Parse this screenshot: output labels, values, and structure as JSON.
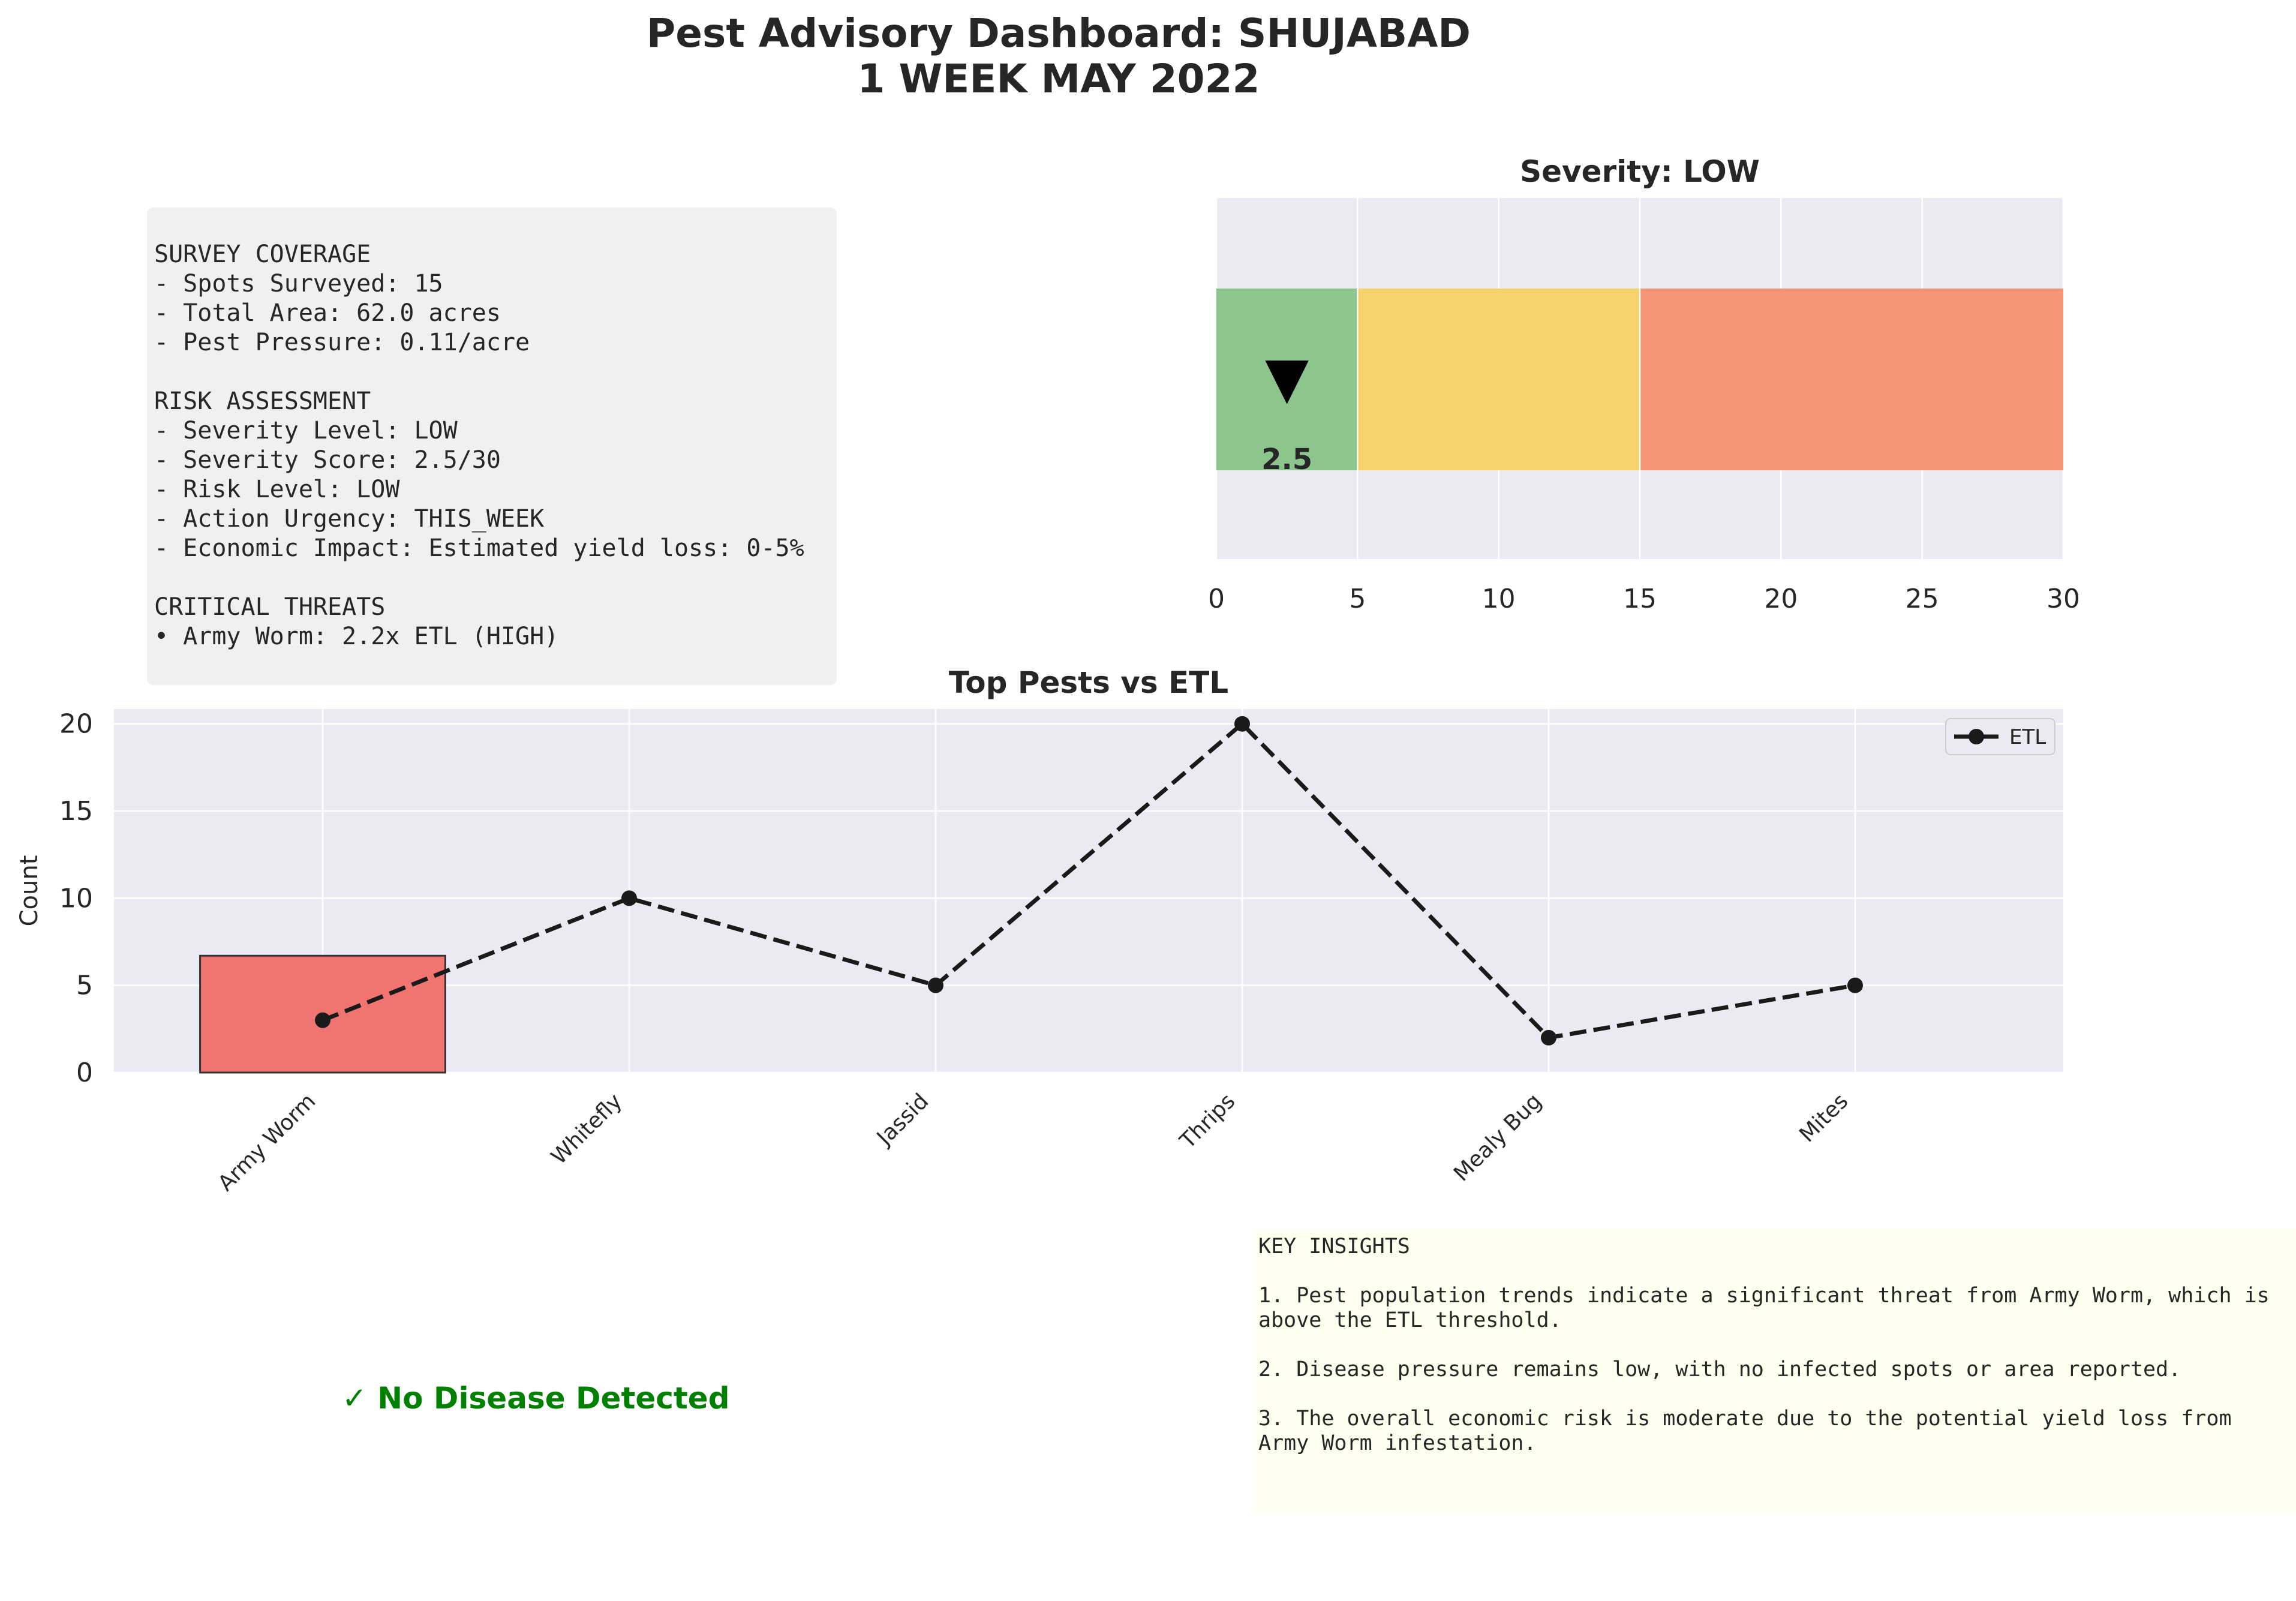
{
  "header": {
    "title_line1": "Pest Advisory Dashboard: SHUJABAD",
    "title_line2": "1 WEEK MAY 2022"
  },
  "summary": {
    "text": "SURVEY COVERAGE\n- Spots Surveyed: 15\n- Total Area: 62.0 acres\n- Pest Pressure: 0.11/acre\n\nRISK ASSESSMENT\n- Severity Level: LOW\n- Severity Score: 2.5/30\n- Risk Level: LOW\n- Action Urgency: THIS_WEEK\n- Economic Impact: Estimated yield loss: 0-5%\n\nCRITICAL THREATS\n• Army Worm: 2.2x ETL (HIGH)"
  },
  "disease": {
    "status": "✓ No Disease Detected",
    "color": "#008000"
  },
  "insights": {
    "text": "KEY INSIGHTS\n\n1. Pest population trends indicate a significant threat from Army Worm, which is above the ETL threshold.\n\n2. Disease pressure remains low, with no infected spots or area reported.\n\n3. The overall economic risk is moderate due to the potential yield loss from Army Worm infestation."
  },
  "colors": {
    "plot_bg": "#eaeaf2",
    "zone_low": "#8dc68c",
    "zone_medium": "#f5d26b",
    "zone_high": "#f59578",
    "bar": "#f07470",
    "etl_line": "#1a1a1a"
  },
  "chart_data": [
    {
      "type": "bar",
      "title": "Severity: LOW",
      "xlim": [
        0,
        30
      ],
      "xticks": [
        0,
        5,
        10,
        15,
        20,
        25,
        30
      ],
      "zones": [
        {
          "from": 0,
          "to": 5,
          "color": "#8dc68c"
        },
        {
          "from": 5,
          "to": 15,
          "color": "#f5d26b"
        },
        {
          "from": 15,
          "to": 30,
          "color": "#f59578"
        }
      ],
      "marker": {
        "value": 2.5,
        "label": "2.5",
        "symbol": "▼"
      },
      "grid": true
    },
    {
      "type": "bar",
      "title": "Top Pests vs ETL",
      "xlabel": "",
      "ylabel": "Count",
      "categories": [
        "Army Worm",
        "Whitefly",
        "Jassid",
        "Thrips",
        "Mealy Bug",
        "Mites"
      ],
      "series": [
        {
          "kind": "bar",
          "values": [
            6.7,
            0,
            0,
            0,
            0,
            0
          ]
        },
        {
          "kind": "line",
          "name": "ETL",
          "style": "dashed",
          "values": [
            3,
            10,
            5,
            20,
            2,
            5
          ]
        }
      ],
      "ylim": [
        0,
        20.85
      ],
      "yticks": [
        0,
        5,
        10,
        15,
        20
      ],
      "legend": "top-right",
      "grid": true
    }
  ]
}
